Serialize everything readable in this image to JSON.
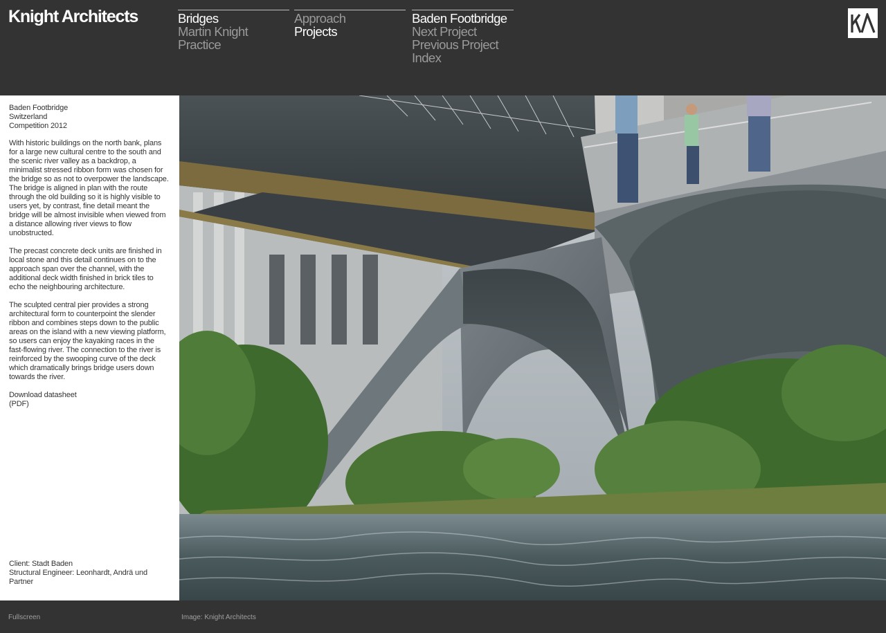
{
  "site": {
    "title": "Knight Architects",
    "logo_mark": "KA"
  },
  "nav": {
    "col1": [
      {
        "label": "Bridges",
        "active": true
      },
      {
        "label": "Martin Knight",
        "active": false
      },
      {
        "label": "Practice",
        "active": false
      }
    ],
    "col2": [
      {
        "label": "Approach",
        "active": false
      },
      {
        "label": "Projects",
        "active": true
      }
    ],
    "col3": [
      {
        "label": "Baden Footbridge",
        "active": true
      },
      {
        "label": "Next Project",
        "active": false
      },
      {
        "label": "Previous Project",
        "active": false
      },
      {
        "label": "Index",
        "active": false
      }
    ]
  },
  "project": {
    "name": "Baden Footbridge",
    "location": "Switzerland",
    "status": "Competition 2012",
    "paragraphs": [
      "With historic buildings on the north bank, plans for a large new cultural centre to the south and the scenic river valley as a backdrop, a minimalist stressed ribbon form was chosen for the bridge so as not to overpower the landscape. The bridge is aligned in plan with the route through the old building so it is highly visible to users yet, by contrast, fine detail meant the bridge will be almost invisible when viewed from a distance allowing river views to flow unobstructed.",
      "The precast concrete deck units are finished in local stone and this detail continues on to the approach span over the channel, with the additional deck width finished in brick tiles to echo the neighbouring architecture.",
      "The sculpted central pier provides a strong architectural form to counterpoint the slender ribbon and combines steps down to the public areas on the island with a new viewing platform, so users can enjoy the kayaking races in the fast-flowing river. The connection to the river is reinforced by the swooping curve of the deck which dramatically brings bridge users down towards the river."
    ],
    "download_label": "Download datasheet",
    "download_format": "(PDF)",
    "client": "Client: Stadt Baden",
    "engineer": "Structural Engineer: Leonhardt, Andrä und Partner"
  },
  "footer": {
    "fullscreen_label": "Fullscreen",
    "image_caption": "Image: Knight Architects"
  },
  "colors": {
    "background": "#333333",
    "panel": "#ffffff",
    "nav_active": "#ffffff",
    "nav_inactive": "#9a9a9a"
  }
}
